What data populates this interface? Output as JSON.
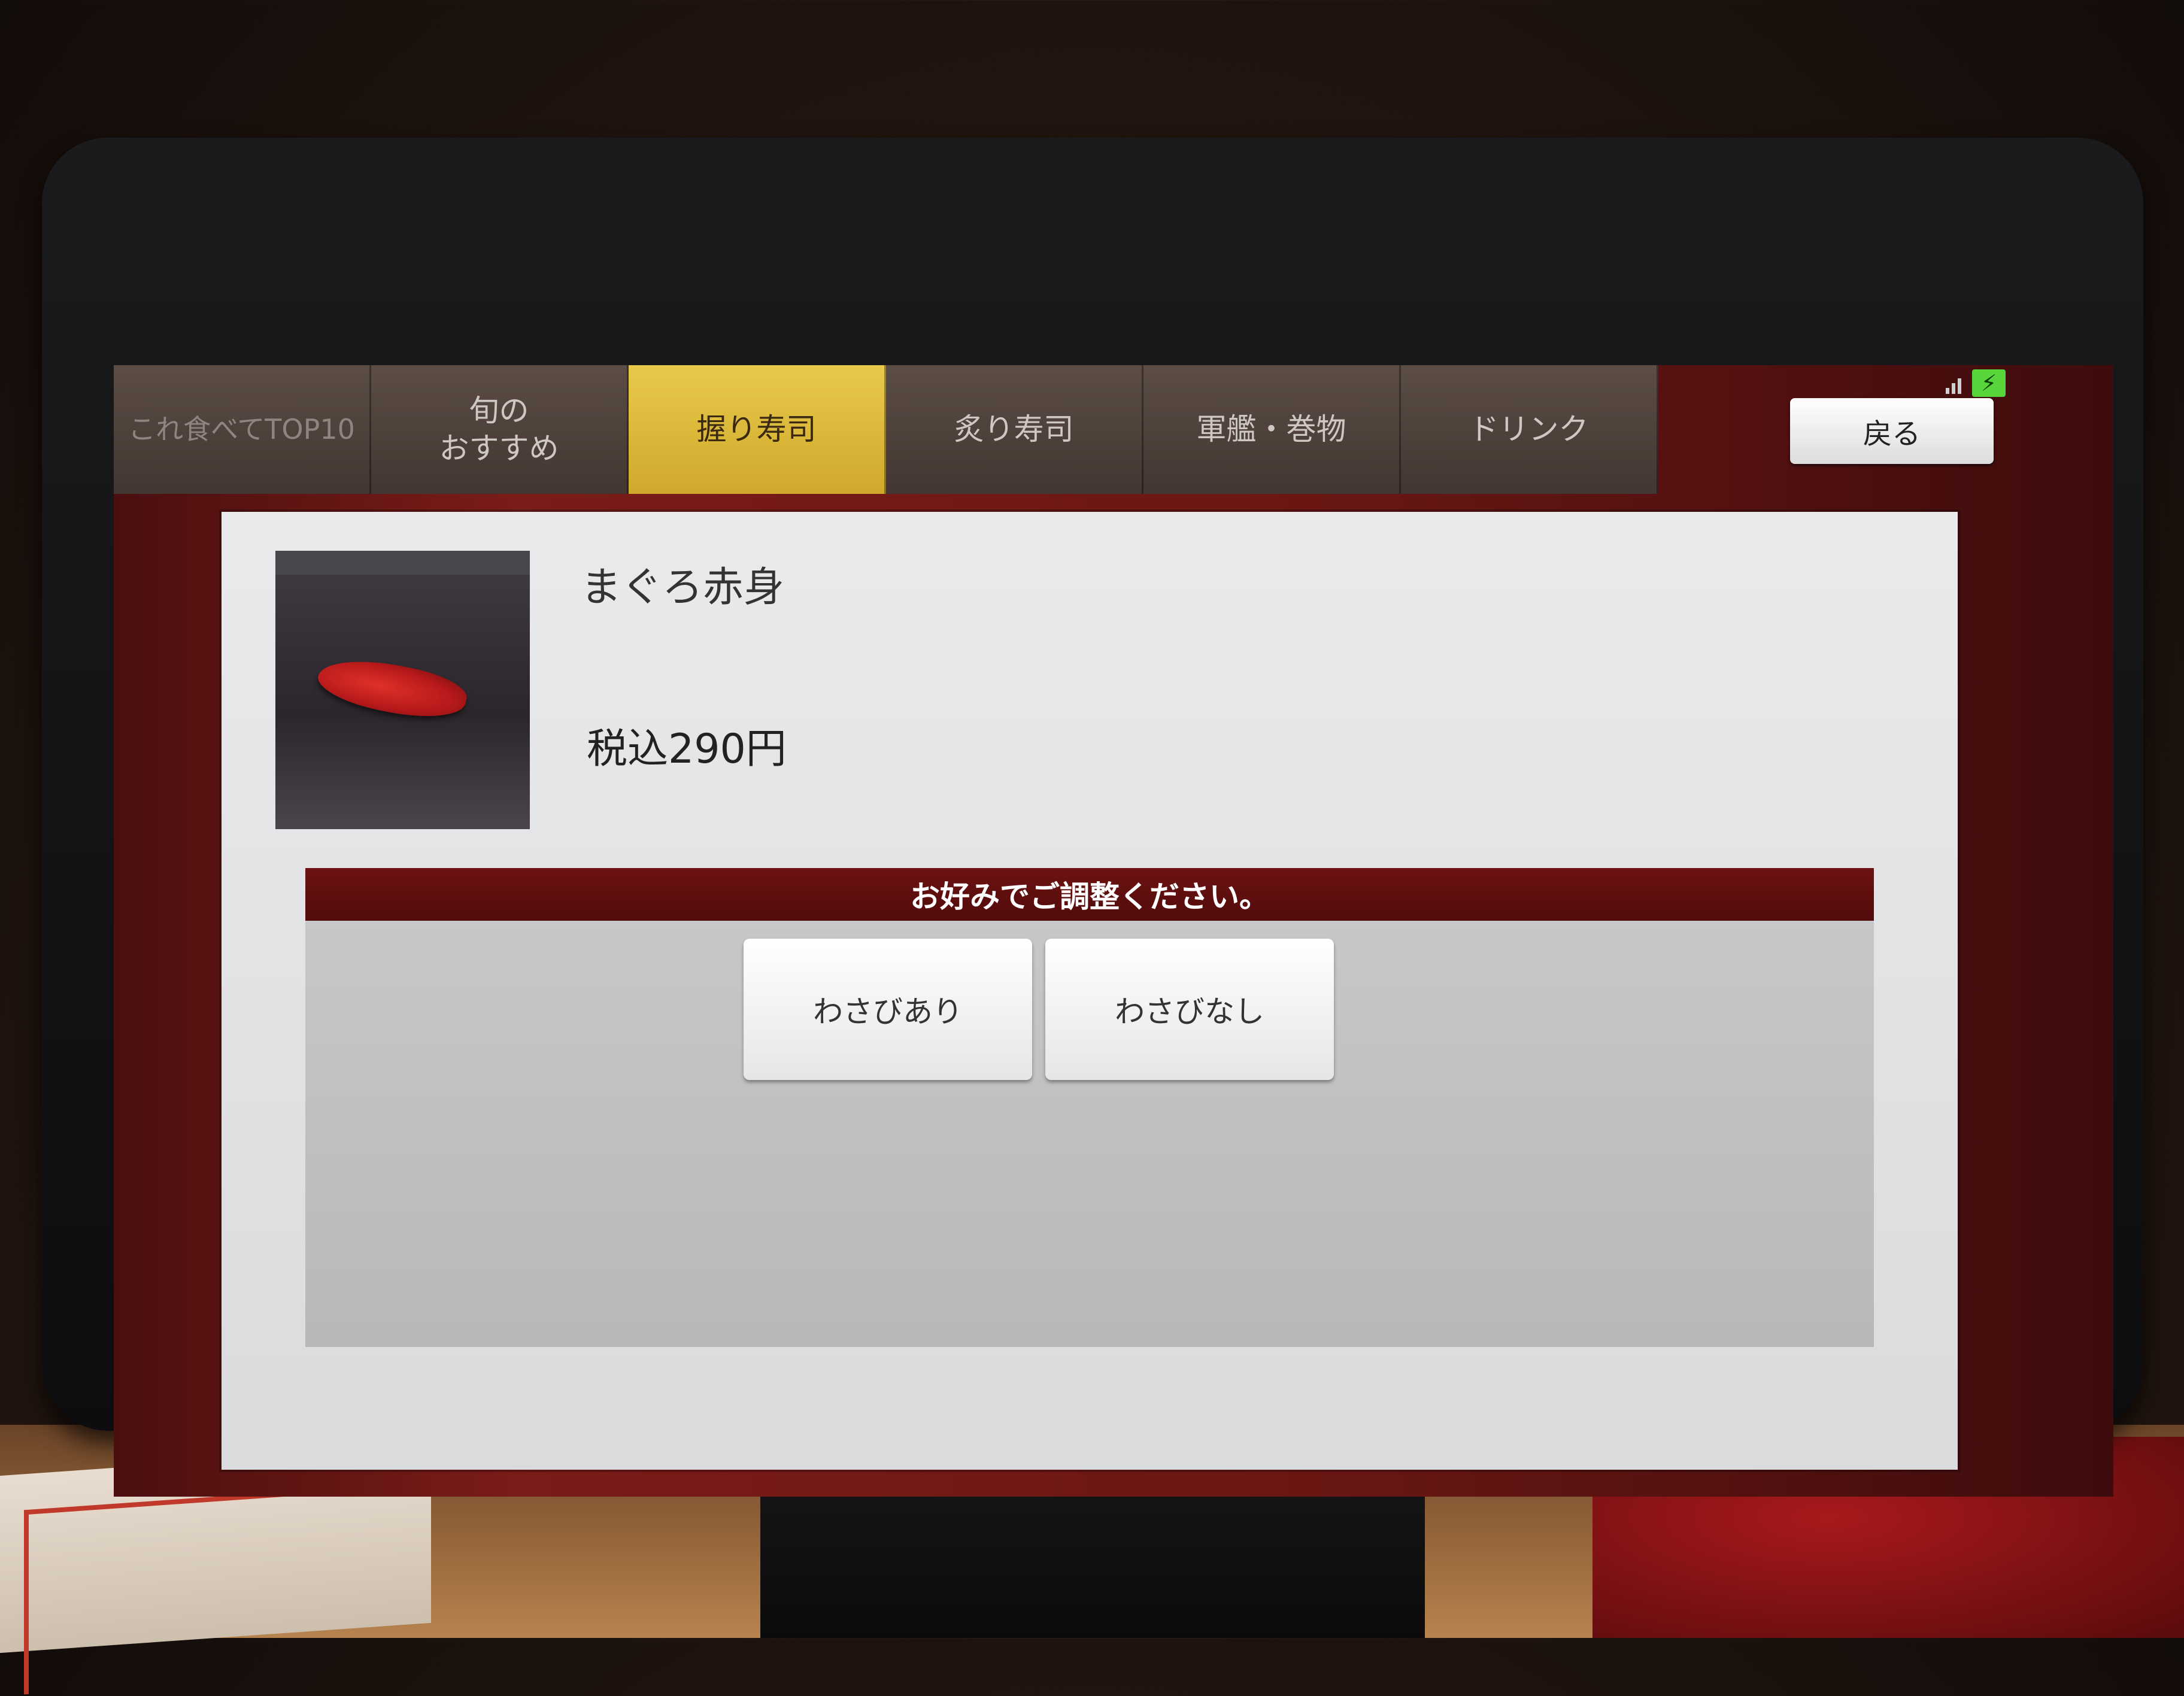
{
  "tabs": [
    {
      "label": "これ食べてTOP10",
      "active": false
    },
    {
      "label": "旬の\nおすすめ",
      "active": false
    },
    {
      "label": "握り寿司",
      "active": true
    },
    {
      "label": "炙り寿司",
      "active": false
    },
    {
      "label": "軍艦・巻物",
      "active": false
    },
    {
      "label": "ドリンク",
      "active": false
    }
  ],
  "header": {
    "back_label": "戻る"
  },
  "status": {
    "signal_icon": "signal-icon",
    "battery_icon": "battery-charging-icon"
  },
  "item": {
    "name": "まぐろ赤身",
    "price": "税込290円"
  },
  "options": {
    "title": "お好みでご調整ください。",
    "buttons": [
      {
        "label": "わさびあり"
      },
      {
        "label": "わさびなし"
      }
    ]
  },
  "colors": {
    "active_tab": "#d8b53a",
    "header_bar": "#5e0e0e",
    "dialog_bg": "#e2e3e5"
  }
}
